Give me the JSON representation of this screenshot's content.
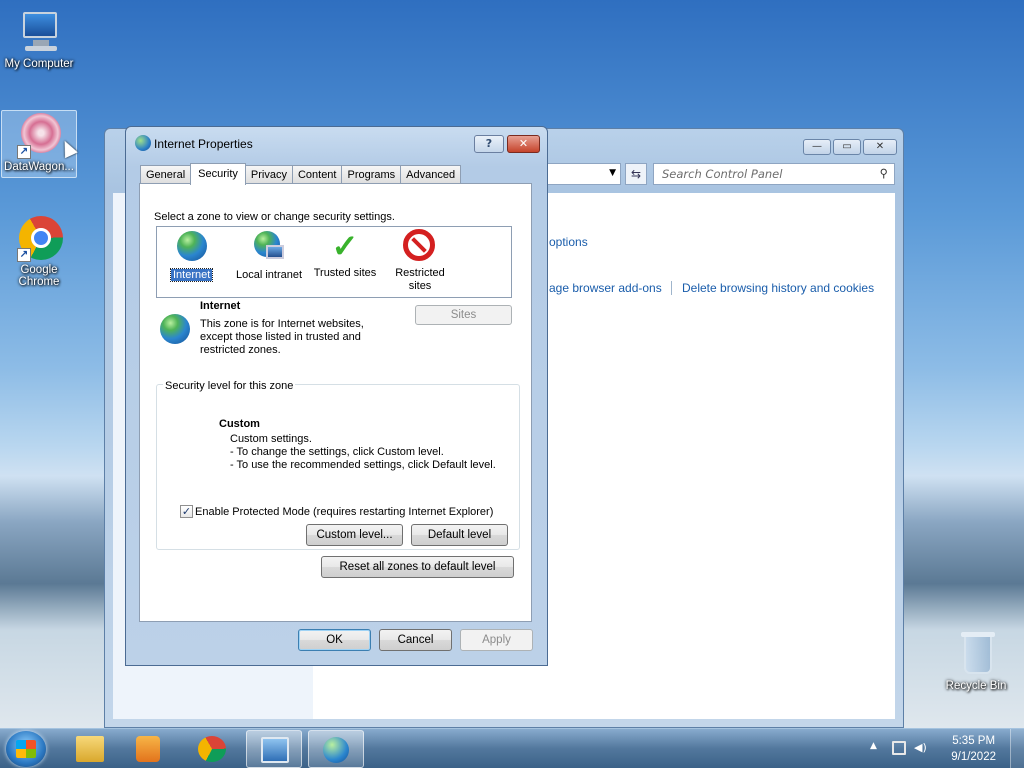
{
  "desktop": {
    "icons": [
      {
        "label": "My Computer",
        "icon": "computer-icon"
      },
      {
        "label": "DataWagon...",
        "icon": "datawagon-icon"
      },
      {
        "label": "Google Chrome",
        "icon": "chrome-icon"
      },
      {
        "label": "Recycle Bin",
        "icon": "recycle-bin-icon"
      }
    ]
  },
  "control_panel": {
    "search_placeholder": "Search Control Panel",
    "links": {
      "options": "options",
      "addons": "age browser add-ons",
      "history": "Delete browsing history and cookies"
    },
    "title_buttons": {
      "min": "—",
      "max": "▭",
      "close": "✕"
    }
  },
  "dialog": {
    "title": "Internet Properties",
    "help_label": "?",
    "close_label": "✕",
    "tabs": [
      "General",
      "Security",
      "Privacy",
      "Content",
      "Programs",
      "Advanced"
    ],
    "active_tab": "Security",
    "zone_prompt": "Select a zone to view or change security settings.",
    "zones": [
      {
        "label": "Internet",
        "icon": "internet-globe-icon",
        "selected": true
      },
      {
        "label": "Local intranet",
        "icon": "local-intranet-icon",
        "selected": false
      },
      {
        "label": "Trusted sites",
        "icon": "checkmark-icon",
        "selected": false
      },
      {
        "label": "Restricted sites",
        "label_line1": "Restricted",
        "label_line2": "sites",
        "icon": "no-entry-icon",
        "selected": false
      }
    ],
    "zone_info": {
      "name": "Internet",
      "desc_line1": "This zone is for Internet websites,",
      "desc_line2": "except those listed in trusted and",
      "desc_line3": "restricted zones."
    },
    "sites_button": "Sites",
    "security_level_title": "Security level for this zone",
    "custom": {
      "title": "Custom",
      "line1": "Custom settings.",
      "line2": "- To change the settings, click Custom level.",
      "line3": "- To use the recommended settings, click Default level."
    },
    "protected_mode": {
      "label": "Enable Protected Mode (requires restarting Internet Explorer)",
      "checked": true,
      "check_glyph": "✓"
    },
    "custom_level_button": "Custom level...",
    "default_level_button": "Default level",
    "reset_all_button": "Reset all zones to default level",
    "ok_button": "OK",
    "cancel_button": "Cancel",
    "apply_button": "Apply"
  },
  "taskbar": {
    "time": "5:35 PM",
    "date": "9/1/2022",
    "items": [
      "windows-explorer-icon",
      "media-player-icon",
      "chrome-icon",
      "control-panel-icon",
      "internet-properties-icon"
    ],
    "tray_arrow": "▲"
  }
}
